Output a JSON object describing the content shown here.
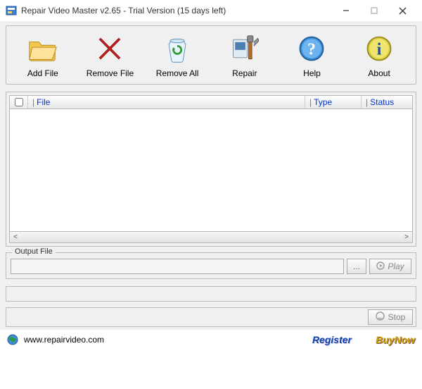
{
  "window": {
    "title": "Repair Video Master v2.65 - Trial Version (15 days left)"
  },
  "toolbar": {
    "add_file": "Add File",
    "remove_file": "Remove File",
    "remove_all": "Remove All",
    "repair": "Repair",
    "help": "Help",
    "about": "About"
  },
  "columns": {
    "file": "File",
    "type": "Type",
    "status": "Status"
  },
  "output": {
    "legend": "Output File",
    "path": "",
    "browse_label": "...",
    "play_label": "Play"
  },
  "stop_label": "Stop",
  "footer": {
    "url": "www.repairvideo.com",
    "register": "Register",
    "buynow": "BuyNow"
  }
}
